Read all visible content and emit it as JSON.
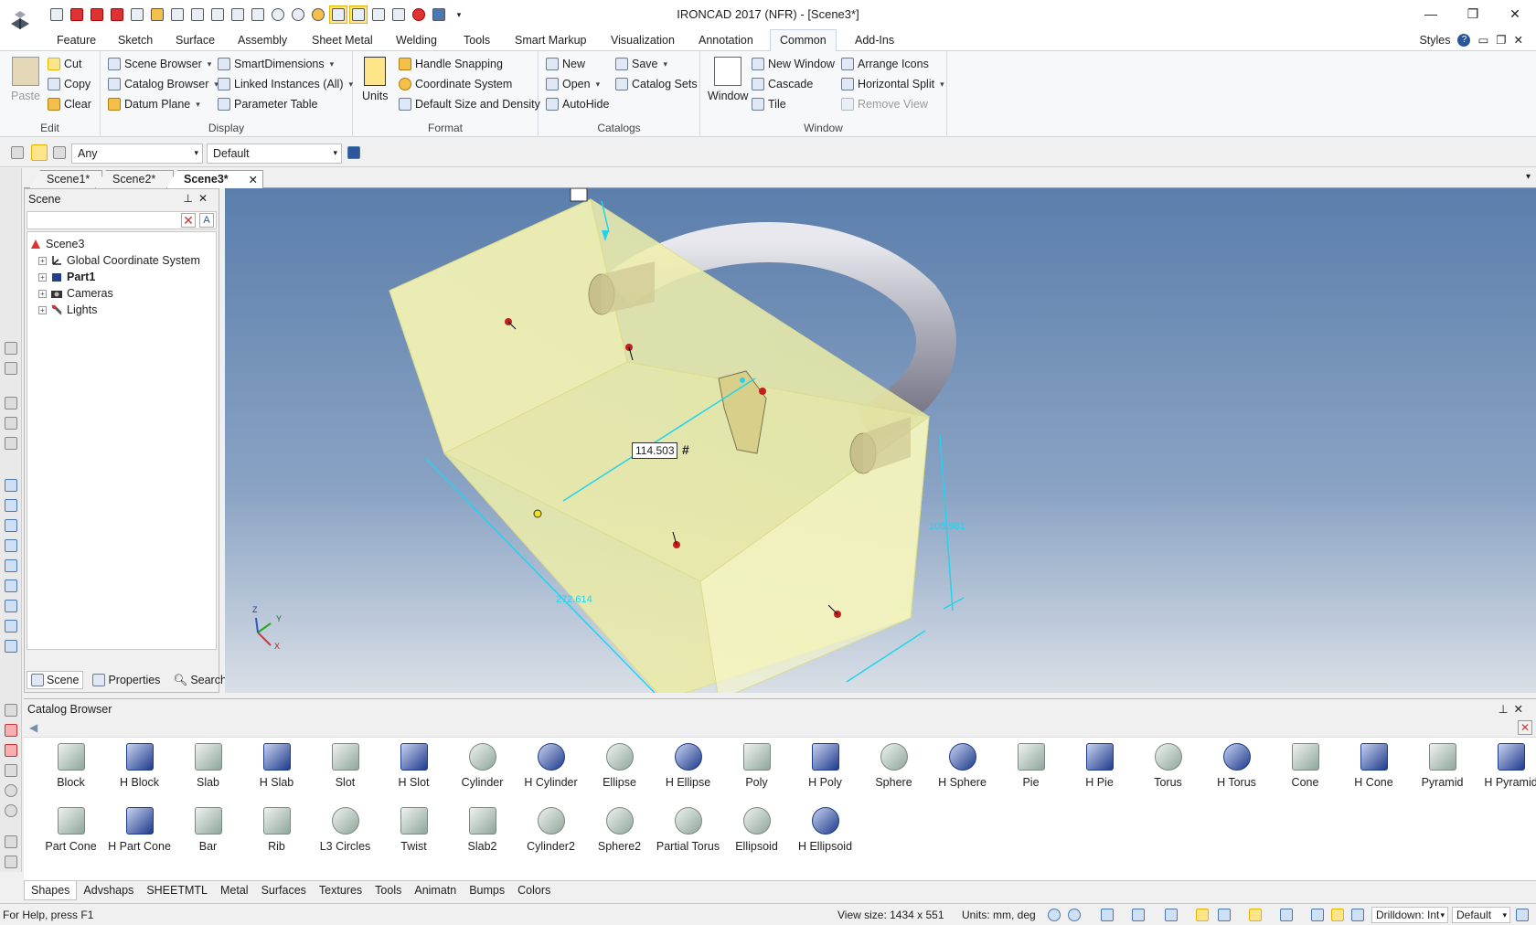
{
  "window": {
    "title": "IRONCAD 2017 (NFR) - [Scene3*]",
    "minimize": "—",
    "maximize": "❐",
    "close": "✕"
  },
  "ribbon_tabs": [
    "Feature",
    "Sketch",
    "Surface",
    "Assembly",
    "Sheet Metal",
    "Welding",
    "Tools",
    "Smart Markup",
    "Visualization",
    "Annotation",
    "Common",
    "Add-Ins"
  ],
  "active_ribbon_tab": "Common",
  "styles_label": "Styles",
  "ribbon": {
    "edit": {
      "label": "Edit",
      "paste": "Paste",
      "cut": "Cut",
      "copy": "Copy",
      "clear": "Clear"
    },
    "display": {
      "label": "Display",
      "scene_browser": "Scene Browser",
      "catalog_browser": "Catalog Browser",
      "datum_plane": "Datum Plane",
      "smart_dimensions": "SmartDimensions",
      "linked_instances": "Linked Instances (All)",
      "parameter_table": "Parameter Table"
    },
    "format": {
      "label": "Format",
      "units": "Units",
      "handle_snapping": "Handle Snapping",
      "coordinate_system": "Coordinate System",
      "default_size": "Default Size and Density"
    },
    "catalogs": {
      "label": "Catalogs",
      "new": "New",
      "open": "Open",
      "autohide": "AutoHide",
      "save": "Save",
      "catalog_sets": "Catalog Sets"
    },
    "window": {
      "label": "Window",
      "window": "Window",
      "new_window": "New Window",
      "cascade": "Cascade",
      "tile": "Tile",
      "arrange_icons": "Arrange Icons",
      "horizontal_split": "Horizontal Split",
      "remove_view": "Remove View"
    }
  },
  "selection_toolbar": {
    "filter": "Any",
    "style": "Default"
  },
  "doc_tabs": [
    "Scene1*",
    "Scene2*",
    "Scene3*"
  ],
  "active_doc_tab": "Scene3*",
  "scene_panel": {
    "title": "Scene",
    "tree": [
      {
        "label": "Scene3",
        "bold": false
      },
      {
        "label": "Global Coordinate System",
        "bold": false
      },
      {
        "label": "Part1",
        "bold": true
      },
      {
        "label": "Cameras",
        "bold": false
      },
      {
        "label": "Lights",
        "bold": false
      }
    ],
    "tabs": [
      "Scene",
      "Properties",
      "Search"
    ]
  },
  "viewport": {
    "dimension_value": "114.503",
    "dimension_hash": "#",
    "dim_length": "272.614",
    "dim_height": "106.981",
    "axis_x": "X",
    "axis_y": "Y",
    "axis_z": "Z"
  },
  "catalog": {
    "title": "Catalog Browser",
    "row1": [
      "Block",
      "H Block",
      "Slab",
      "H Slab",
      "Slot",
      "H Slot",
      "Cylinder",
      "H Cylinder",
      "Ellipse",
      "H Ellipse",
      "Poly",
      "H Poly",
      "Sphere",
      "H Sphere",
      "Pie",
      "H Pie",
      "Torus",
      "H Torus",
      "Cone",
      "H Cone",
      "Pyramid",
      "H Pyramid"
    ],
    "row2": [
      "Part Cone",
      "H Part Cone",
      "Bar",
      "Rib",
      "L3 Circles",
      "Twist",
      "Slab2",
      "Cylinder2",
      "Sphere2",
      "Partial Torus",
      "Ellipsoid",
      "H Ellipsoid"
    ],
    "tabs": [
      "Shapes",
      "Advshaps",
      "SHEETMTL",
      "Metal",
      "Surfaces",
      "Textures",
      "Tools",
      "Animatn",
      "Bumps",
      "Colors"
    ],
    "active_tab": "Shapes"
  },
  "statusbar": {
    "help": "For Help, press F1",
    "view_size": "View size: 1434 x  551",
    "units": "Units: mm, deg",
    "drilldown": "Drilldown: Int",
    "style": "Default"
  },
  "colors": {
    "accent": "#2b579a",
    "viewport_top": "#5b7eab",
    "viewport_bottom": "#d9dfe6",
    "part_highlight": "#f3f3a0",
    "dimension_line": "#22d3ee"
  }
}
